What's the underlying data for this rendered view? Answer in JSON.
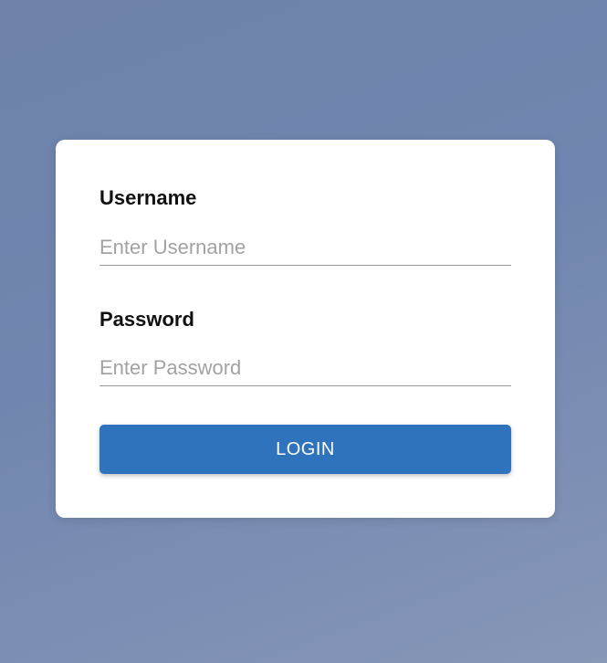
{
  "login_form": {
    "username": {
      "label": "Username",
      "placeholder": "Enter Username",
      "value": ""
    },
    "password": {
      "label": "Password",
      "placeholder": "Enter Password",
      "value": ""
    },
    "submit_label": "LOGIN"
  },
  "colors": {
    "primary_button": "#2f73bd",
    "card_background": "#ffffff",
    "page_background": "#7086b0"
  }
}
